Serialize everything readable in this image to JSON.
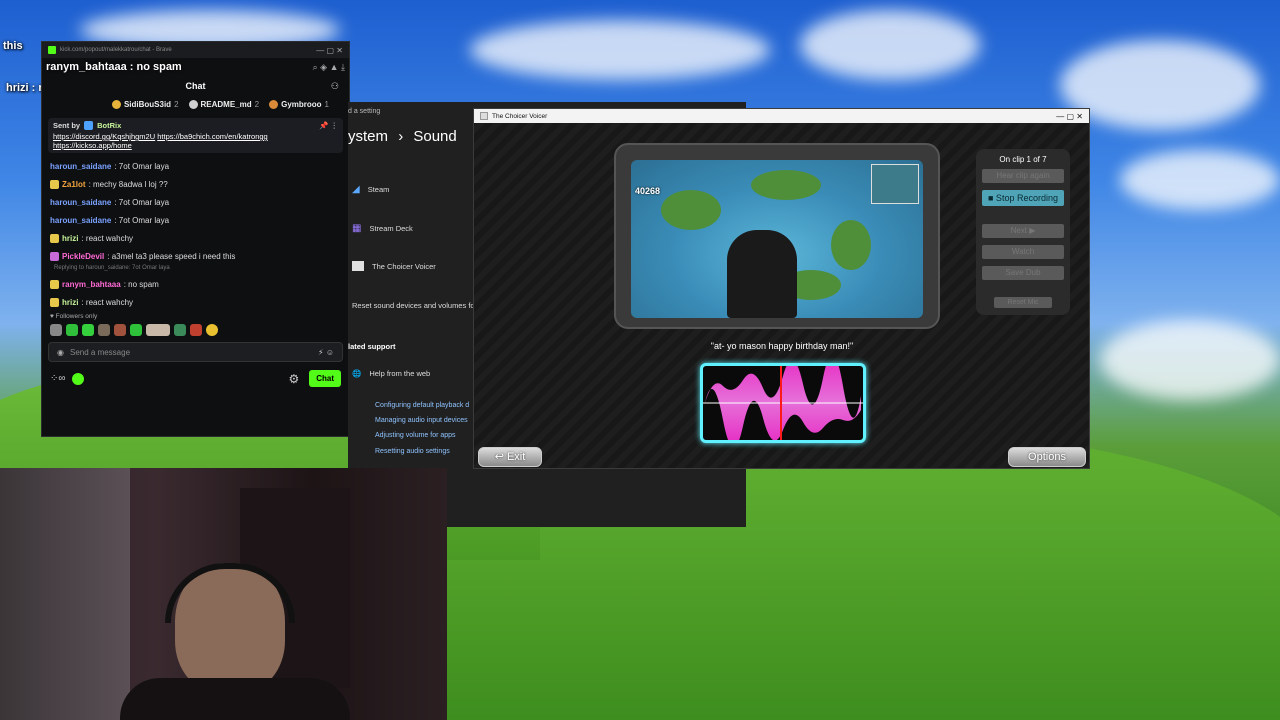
{
  "overlay": {
    "this_label": "this",
    "top_user": "ranym_bahtaaa : no spam",
    "second_line": "hrizi : react wahchy"
  },
  "chat": {
    "url": "kick.com/popout/malekkatrou/chat - Brave",
    "header": "Chat",
    "gifters": [
      {
        "name": "SidiBouS3id",
        "count": "2",
        "color": "#e8b33a"
      },
      {
        "name": "README_md",
        "count": "2",
        "color": "#cfcfcf"
      },
      {
        "name": "Gymbrooo",
        "count": "1",
        "color": "#d98b3a"
      }
    ],
    "pinned": {
      "sent_by": "Sent by",
      "sender": "BotRix",
      "links": [
        "https://discord.gg/Kqshjhgm2U",
        "https://ba9chich.com/en/katrongg",
        "https://kickso.app/home"
      ]
    },
    "messages": [
      {
        "user": "haroun_saidane",
        "text": ": 7ot Omar laya",
        "cls": "u-blue",
        "badge": ""
      },
      {
        "user": "Za1lot",
        "text": ": mechy 8adwa l loj ??",
        "cls": "u-orange",
        "badge": "#e8c84a"
      },
      {
        "user": "haroun_saidane",
        "text": ": 7ot Omar laya",
        "cls": "u-blue",
        "badge": ""
      },
      {
        "user": "haroun_saidane",
        "text": ": 7ot Omar laya",
        "cls": "u-blue",
        "badge": ""
      },
      {
        "user": "hrizi",
        "text": ": react wahchy",
        "cls": "u-green",
        "badge": "#e8c84a"
      },
      {
        "user": "PickleDevil",
        "text": ": a3mel ta3 please speed i need this",
        "cls": "u-pink",
        "badge": "#c86bd9"
      }
    ],
    "reply_note": "Replying to haroun_saidane: 7ot Omar laya",
    "messages2": [
      {
        "user": "ranym_bahtaaa",
        "text": ": no spam",
        "cls": "u-pink",
        "badge": "#e8c84a"
      },
      {
        "user": "hrizi",
        "text": ": react wahchy",
        "cls": "u-green",
        "badge": "#e8c84a"
      }
    ],
    "followers_only": "Followers only",
    "send_placeholder": "Send a message",
    "chat_button": "Chat"
  },
  "settings": {
    "title": "d a setting",
    "crumb_system": "ystem",
    "crumb_sep": "›",
    "crumb_sound": "Sound",
    "rows": [
      "Steam",
      "Stream Deck",
      "The Choicer Voicer",
      "Reset sound devices and volumes fo"
    ],
    "support_title": "lated support",
    "help_web": "Help from the web",
    "links": [
      "Configuring default playback d",
      "Managing audio input devices",
      "Adjusting volume for apps",
      "Resetting audio settings"
    ]
  },
  "voicer": {
    "title": "The Choicer Voicer",
    "clip_status": "On clip 1 of 7",
    "hear_again": "Hear clip again",
    "stop_recording": "■ Stop Recording",
    "next": "Next ▶",
    "watch": "Watch",
    "save_dub": "Save Dub",
    "reset_mic": "Reset Mic",
    "caption": "\"at- yo mason happy birthday man!\"",
    "exit": "↩ Exit",
    "options": "Options",
    "video_counter": "40268"
  }
}
